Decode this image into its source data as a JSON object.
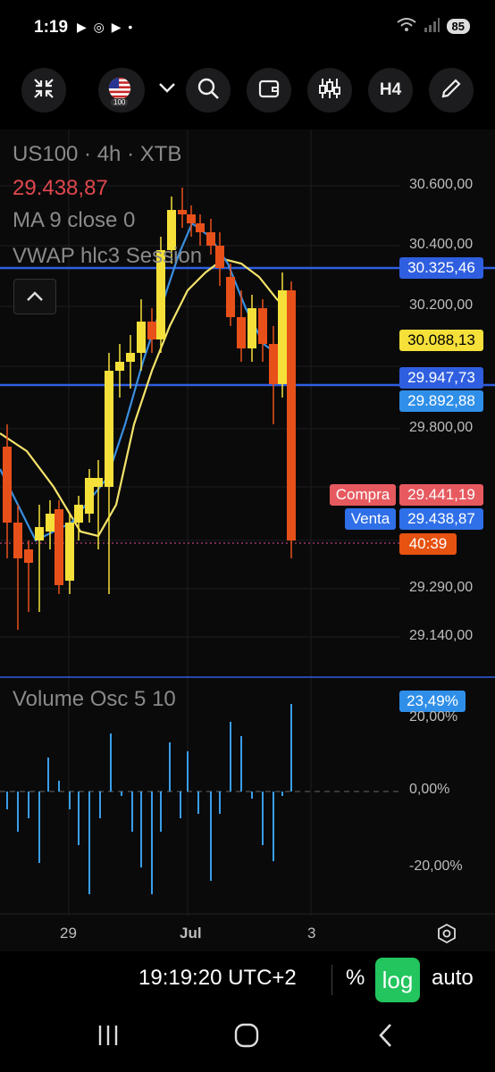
{
  "status_bar": {
    "time": "1:19",
    "notif_icons": "▶ ◎ ▶ •",
    "battery": "85"
  },
  "toolbar": {
    "buttons": [
      "collapse-icon",
      "us-flag-icon",
      "chevron-down-icon",
      "search-icon",
      "wallet-icon",
      "indicators-icon",
      "timeframe",
      "pencil-icon"
    ],
    "flag_label": "100",
    "timeframe_label": "H4"
  },
  "chart": {
    "symbol_line": "US100 · 4h · XTB",
    "last_price": "29.438,87",
    "indicator_ma": "MA 9 close 0",
    "indicator_vwap": "VWAP hlc3 Session",
    "price_scale": [
      "30.600,00",
      "30.400,00",
      "30.200,00",
      "29.800,00",
      "29.290,00",
      "29.140,00"
    ],
    "price_tags": {
      "upper_level": "30.325,46",
      "yellow_level": "30.088,13",
      "lower_level": "29.947,73",
      "blue_level": "29.892,88",
      "compra_label": "Compra",
      "compra_value": "29.441,19",
      "venta_label": "Venta",
      "venta_value": "29.438,87",
      "countdown": "40:39"
    },
    "colors": {
      "up": "#f5e03a",
      "down": "#e8501a",
      "ma": "#3a8fe0",
      "vwap": "#f5e36a",
      "level_line": "#2f5fe0",
      "osc": "#3a9ee8",
      "compra_bg": "#e65a5f",
      "venta_bg": "#2f6fe8",
      "countdown_bg": "#e65210"
    }
  },
  "oscillator": {
    "title": "Volume Osc 5 10",
    "current_value": "23,49%",
    "scale": [
      "20,00%",
      "0,00%",
      "-20,00%"
    ]
  },
  "time_axis": {
    "labels": [
      "29",
      "Jul",
      "3"
    ]
  },
  "bottom_bar": {
    "clock": "19:19:20 UTC+2",
    "percent_label": "%",
    "log_label": "log",
    "auto_label": "auto"
  }
}
